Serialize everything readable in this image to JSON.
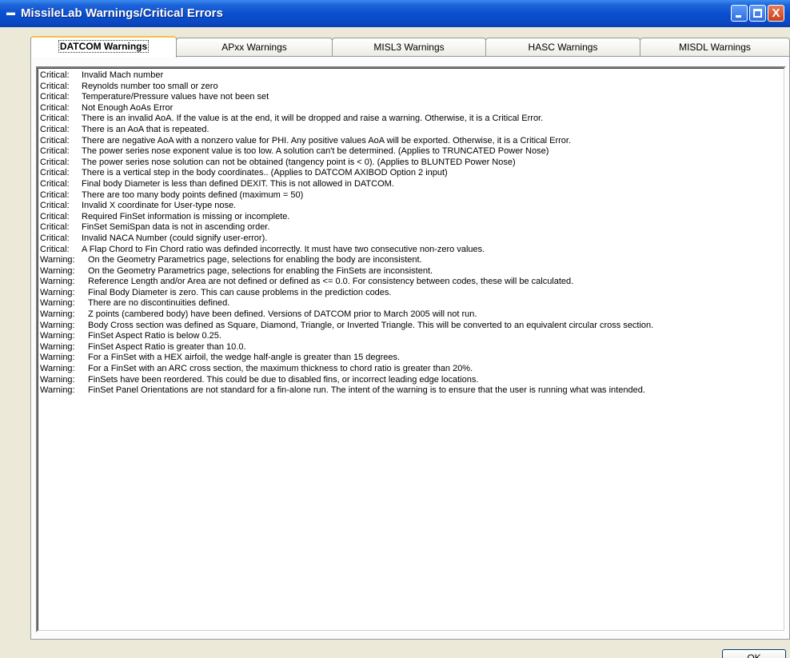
{
  "window": {
    "title": "MissileLab Warnings/Critical Errors",
    "close_glyph": "X"
  },
  "tabs": [
    {
      "label": "DATCOM Warnings",
      "active": true
    },
    {
      "label": "APxx Warnings",
      "active": false
    },
    {
      "label": "MISL3 Warnings",
      "active": false
    },
    {
      "label": "HASC Warnings",
      "active": false
    },
    {
      "label": "MISDL Warnings",
      "active": false
    }
  ],
  "messages": [
    {
      "level": "Critical:",
      "text": "Invalid Mach number"
    },
    {
      "level": "Critical:",
      "text": "Reynolds number too small or zero"
    },
    {
      "level": "Critical:",
      "text": "Temperature/Pressure values have not been set"
    },
    {
      "level": "Critical:",
      "text": "Not Enough AoAs Error"
    },
    {
      "level": "Critical:",
      "text": "There is an invalid AoA.  If the value is at the end, it will be dropped and raise a warning.  Otherwise, it is a Critical Error."
    },
    {
      "level": "Critical:",
      "text": "There is an AoA that is repeated."
    },
    {
      "level": "Critical:",
      "text": "There are negative AoA with a nonzero value for PHI.  Any positive values AoA will be exported.  Otherwise, it is a Critical Error."
    },
    {
      "level": "Critical:",
      "text": "The power series nose exponent value is too low.  A solution can't be determined. (Applies to TRUNCATED Power Nose)"
    },
    {
      "level": "Critical:",
      "text": "The power series nose solution can not be obtained (tangency point is < 0). (Applies to BLUNTED Power Nose)"
    },
    {
      "level": "Critical:",
      "text": "There is a vertical step in the body coordinates..  (Applies to DATCOM AXIBOD Option 2 input)"
    },
    {
      "level": "Critical:",
      "text": "Final body Diameter is less than defined DEXIT.  This is not allowed in DATCOM."
    },
    {
      "level": "Critical:",
      "text": "There are too many body points defined (maximum = 50)"
    },
    {
      "level": "Critical:",
      "text": "Invalid X coordinate for User-type nose."
    },
    {
      "level": "Critical:",
      "text": "Required FinSet information is missing or incomplete."
    },
    {
      "level": "Critical:",
      "text": "FinSet SemiSpan data is not in ascending order."
    },
    {
      "level": "Critical:",
      "text": "Invalid NACA Number (could signify user-error)."
    },
    {
      "level": "Critical:",
      "text": "A Flap Chord to Fin Chord ratio was definded incorrectly.  It must have two consecutive non-zero values."
    },
    {
      "level": "Warning:",
      "text": "On the Geometry Parametrics page, selections for enabling the body are inconsistent."
    },
    {
      "level": "Warning:",
      "text": "On the Geometry Parametrics page, selections for enabling the FinSets are inconsistent."
    },
    {
      "level": "Warning:",
      "text": "Reference Length and/or Area are not defined or defined as <= 0.0.  For consistency between codes, these will be calculated."
    },
    {
      "level": "Warning:",
      "text": "Final Body Diameter is zero.  This can cause problems in the prediction codes."
    },
    {
      "level": "Warning:",
      "text": "There are no discontinuities defined."
    },
    {
      "level": "Warning:",
      "text": "Z points (cambered body) have been defined.  Versions of DATCOM prior to March 2005 will not run."
    },
    {
      "level": "Warning:",
      "text": "Body Cross section was defined as Square, Diamond, Triangle, or Inverted Triangle.  This will be converted to an equivalent circular cross section."
    },
    {
      "level": "Warning:",
      "text": "FinSet Aspect Ratio is below 0.25."
    },
    {
      "level": "Warning:",
      "text": "FinSet Aspect Ratio is greater than 10.0."
    },
    {
      "level": "Warning:",
      "text": "For a FinSet with a HEX airfoil, the wedge half-angle is greater than 15 degrees."
    },
    {
      "level": "Warning:",
      "text": "For a FinSet with an ARC cross section, the maximum thickness to chord ratio is greater than 20%."
    },
    {
      "level": "Warning:",
      "text": "FinSets have been reordered.  This could be due to disabled fins, or incorrect leading edge locations."
    },
    {
      "level": "Warning:",
      "text": "FinSet Panel Orientations are not standard for a fin-alone run.  The intent of the warning is to ensure that the user is running what was intended."
    }
  ],
  "buttons": {
    "ok_label": "OK"
  },
  "colors": {
    "titlebar": "#0a4fd0",
    "window_bg": "#ece9d8",
    "active_tab_highlight": "#f6c14b"
  }
}
